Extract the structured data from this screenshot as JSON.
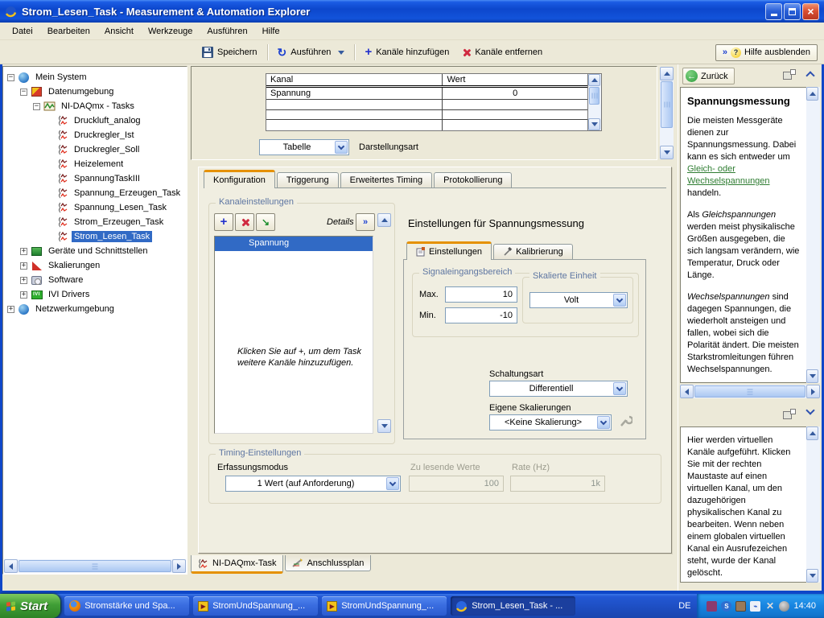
{
  "window": {
    "title": "Strom_Lesen_Task - Measurement & Automation Explorer"
  },
  "menu": {
    "items": [
      "Datei",
      "Bearbeiten",
      "Ansicht",
      "Werkzeuge",
      "Ausführen",
      "Hilfe"
    ]
  },
  "toolbar": {
    "save": "Speichern",
    "run": "Ausführen",
    "add_channels": "Kanäle hinzufügen",
    "remove_channels": "Kanäle entfernen",
    "help_toggle": "Hilfe ausblenden"
  },
  "tree": {
    "items": [
      {
        "label": "Mein System"
      },
      {
        "label": "Datenumgebung"
      },
      {
        "label": "NI-DAQmx - Tasks"
      },
      {
        "label": "Druckluft_analog"
      },
      {
        "label": "Druckregler_Ist"
      },
      {
        "label": "Druckregler_Soll"
      },
      {
        "label": "Heizelement"
      },
      {
        "label": "SpannungTaskIII"
      },
      {
        "label": "Spannung_Erzeugen_Task"
      },
      {
        "label": "Spannung_Lesen_Task"
      },
      {
        "label": "Strom_Erzeugen_Task"
      },
      {
        "label": "Strom_Lesen_Task"
      },
      {
        "label": "Geräte und Schnittstellen"
      },
      {
        "label": "Skalierungen"
      },
      {
        "label": "Software"
      },
      {
        "label": "IVI Drivers"
      },
      {
        "label": "Netzwerkumgebung"
      }
    ]
  },
  "top": {
    "table": {
      "headers": [
        "Kanal",
        "Wert"
      ],
      "rows": [
        [
          "Spannung",
          "0"
        ]
      ]
    },
    "view_value": "Tabelle",
    "view_label": "Darstellungsart"
  },
  "tabs": {
    "items": [
      "Konfiguration",
      "Triggerung",
      "Erweitertes Timing",
      "Protokollierung"
    ]
  },
  "channels": {
    "group": "Kanaleinstellungen",
    "details": "Details",
    "selected": "Spannung",
    "hint": "Klicken Sie auf +, um dem Task weitere Kanäle hinzuzufügen."
  },
  "meas": {
    "title": "Einstellungen für Spannungsmessung",
    "tab_settings": "Einstellungen",
    "tab_cal": "Kalibrierung",
    "group_signal": "Signaleingangsbereich",
    "max_label": "Max.",
    "max": "10",
    "min_label": "Min.",
    "min": "-10",
    "group_unit": "Skalierte Einheit",
    "unit": "Volt",
    "circuit_label": "Schaltungsart",
    "circuit": "Differentiell",
    "scales_label": "Eigene Skalierungen",
    "scales": "<Keine Skalierung>"
  },
  "timing": {
    "group": "Timing-Einstellungen",
    "mode_label": "Erfassungsmodus",
    "mode": "1 Wert (auf Anforderung)",
    "samples_label": "Zu lesende Werte",
    "samples": "100",
    "rate_label": "Rate (Hz)",
    "rate": "1k"
  },
  "bottom_tabs": {
    "items": [
      "NI-DAQmx-Task",
      "Anschlussplan"
    ]
  },
  "help": {
    "back": "Zurück",
    "title": "Spannungsmessung",
    "p1_pre": "Die meisten Messgeräte dienen zur Spannungsmessung. Dabei kann es sich entweder um ",
    "p1_link": "Gleich- oder Wechselspannungen",
    "p1_post": " handeln.",
    "p2_pre": "Als ",
    "p2_italic": "Gleichspannungen",
    "p2_post": " werden meist physikalische Größen ausgegeben, die sich langsam verändern, wie Temperatur, Druck oder Länge.",
    "p3_italic": "Wechselspannungen",
    "p3_post": " sind dagegen Spannungen, die wiederholt ansteigen und fallen, wobei sich die Polarität ändert. Die meisten Starkstromleitungen führen Wechselspannungen.",
    "p4": "Hier werden virtuellen Kanäle aufgeführt. Klicken Sie mit der rechten Maustaste auf einen virtuellen Kanal, um den dazugehörigen physikalischen Kanal zu bearbeiten. Wenn neben einem globalen virtuellen Kanal ein Ausrufezeichen steht, wurde der Kanal gelöscht."
  },
  "taskbar": {
    "start": "Start",
    "tasks": [
      "Stromstärke und Spa...",
      "StromUndSpannung_...",
      "StromUndSpannung_...",
      "Strom_Lesen_Task - ..."
    ],
    "lang": "DE",
    "time": "14:40"
  },
  "colors": {
    "selection": "#316ac5",
    "tab_accent": "#e59100",
    "link_green": "#2f7d32",
    "titlebar_blue": "#0d47cc"
  }
}
